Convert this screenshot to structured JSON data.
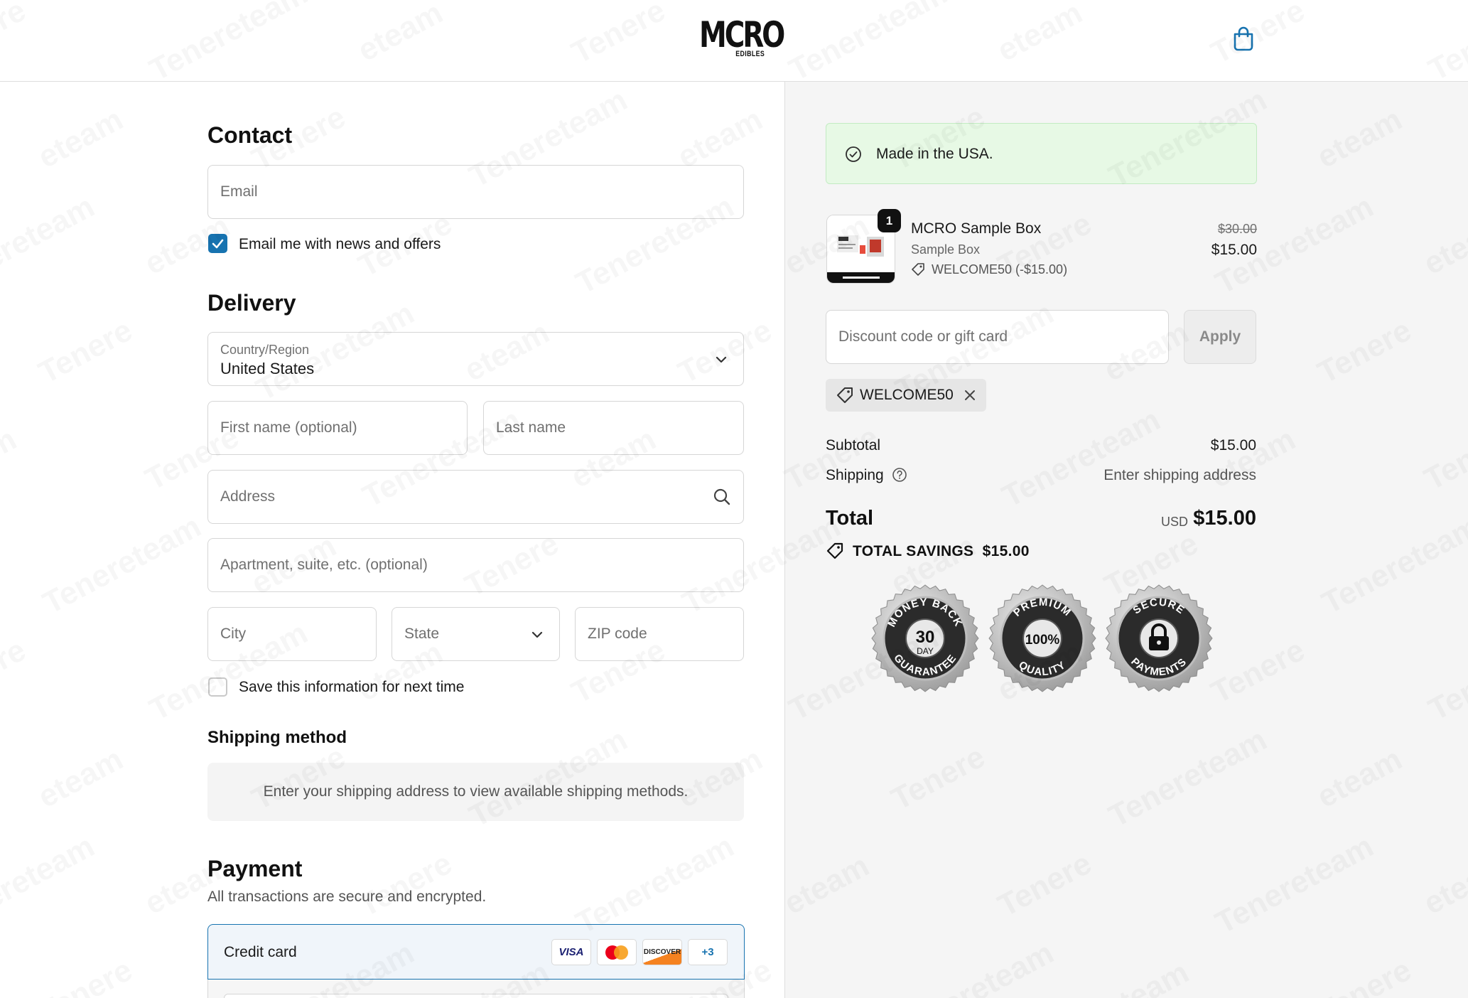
{
  "header": {
    "logo_main": "MCRO",
    "logo_sub": "EDIBLES",
    "cart_icon": "shopping-bag-icon"
  },
  "contact": {
    "title": "Contact",
    "email_placeholder": "Email",
    "newsletter_label": "Email me with news and offers",
    "newsletter_checked": true
  },
  "delivery": {
    "title": "Delivery",
    "country_label": "Country/Region",
    "country_value": "United States",
    "first_name_placeholder": "First name (optional)",
    "last_name_placeholder": "Last name",
    "address_placeholder": "Address",
    "apartment_placeholder": "Apartment, suite, etc. (optional)",
    "city_placeholder": "City",
    "state_placeholder": "State",
    "zip_placeholder": "ZIP code",
    "save_info_label": "Save this information for next time",
    "save_info_checked": false
  },
  "shipping_method": {
    "title": "Shipping method",
    "note": "Enter your shipping address to view available shipping methods."
  },
  "payment": {
    "title": "Payment",
    "subtitle": "All transactions are secure and encrypted.",
    "credit_card_label": "Credit card",
    "cards": [
      "VISA",
      "Mastercard",
      "DISCOVER",
      "+3"
    ]
  },
  "summary": {
    "banner": "Made in the USA.",
    "item": {
      "quantity": "1",
      "name": "MCRO Sample Box",
      "variant": "Sample Box",
      "discount": "WELCOME50 (-$15.00)",
      "original_price": "$30.00",
      "price": "$15.00"
    },
    "discount_placeholder": "Discount code or gift card",
    "apply_label": "Apply",
    "applied_code": "WELCOME50",
    "subtotal_label": "Subtotal",
    "subtotal_value": "$15.00",
    "shipping_label": "Shipping",
    "shipping_value": "Enter shipping address",
    "total_label": "Total",
    "total_currency": "USD",
    "total_value": "$15.00",
    "savings_label": "TOTAL SAVINGS",
    "savings_value": "$15.00",
    "seals": [
      {
        "top": "MONEY BACK",
        "center": "30",
        "center_sub": "DAY",
        "bottom": "GUARANTEE"
      },
      {
        "top": "PREMIUM",
        "center": "100%",
        "bottom": "QUALITY"
      },
      {
        "top": "SECURE",
        "center": "",
        "bottom": "PAYMENTS"
      }
    ]
  },
  "colors": {
    "accent": "#1773b0",
    "banner_bg": "#e7f9e5",
    "summary_bg": "#f5f5f5"
  }
}
